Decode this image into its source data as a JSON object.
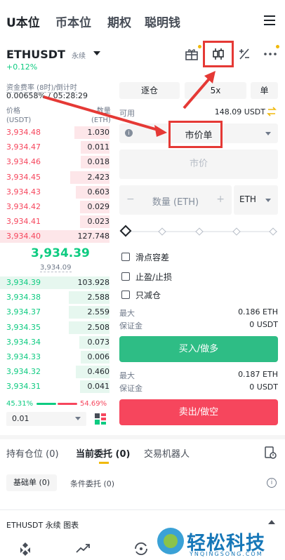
{
  "nav": {
    "tabs": [
      "U本位",
      "币本位",
      "期权",
      "聪明钱"
    ]
  },
  "symbol": {
    "name": "ETHUSDT",
    "type": "永续",
    "change": "+0.12%"
  },
  "funding": {
    "label": "资金费率 (8时)/倒计时",
    "value": "0.00658% / 05:28:29"
  },
  "orderbook": {
    "price_label": "价格",
    "price_unit": "(USDT)",
    "qty_label": "数量",
    "qty_unit": "(ETH)",
    "asks": [
      [
        "3,934.48",
        "1.030"
      ],
      [
        "3,934.47",
        "0.011"
      ],
      [
        "3,934.46",
        "0.018"
      ],
      [
        "3,934.45",
        "2.423"
      ],
      [
        "3,934.43",
        "0.603"
      ],
      [
        "3,934.42",
        "0.029"
      ],
      [
        "3,934.41",
        "0.023"
      ],
      [
        "3,934.40",
        "127.748"
      ]
    ],
    "last_price": "3,934.39",
    "mark_price": "3,934.09",
    "bids": [
      [
        "3,934.39",
        "103.928"
      ],
      [
        "3,934.38",
        "2.588"
      ],
      [
        "3,934.37",
        "2.559"
      ],
      [
        "3,934.35",
        "2.508"
      ],
      [
        "3,934.34",
        "0.073"
      ],
      [
        "3,934.33",
        "0.006"
      ],
      [
        "3,934.32",
        "0.460"
      ],
      [
        "3,934.31",
        "0.041"
      ]
    ],
    "buy_ratio": "45.31%",
    "sell_ratio": "54.69%",
    "precision": "0.01"
  },
  "form": {
    "margin_mode": "逐仓",
    "leverage": "5x",
    "mode": "单",
    "available_label": "可用",
    "available": "148.09 USDT",
    "order_type": "市价单",
    "price_placeholder": "市价",
    "qty_placeholder": "数量 (ETH)",
    "qty_unit": "ETH",
    "minus": "−",
    "plus": "+",
    "options": [
      "滑点容差",
      "止盈/止损",
      "只减仓"
    ],
    "buy_max_label": "最大",
    "buy_max": "0.186 ETH",
    "buy_margin_label": "保证金",
    "buy_margin": "0 USDT",
    "buy_btn": "买入/做多",
    "sell_max_label": "最大",
    "sell_max": "0.187 ETH",
    "sell_margin_label": "保证金",
    "sell_margin": "0 USDT",
    "sell_btn": "卖出/做空"
  },
  "orders": {
    "tabs": [
      "持有仓位 (0)",
      "当前委托 (0)",
      "交易机器人"
    ],
    "sub_tabs": [
      "基础单 (0)",
      "条件委托 (0)"
    ]
  },
  "footer": {
    "chart_label": "ETHUSDT 永续 图表"
  },
  "watermark": {
    "cn": "轻松科技",
    "en": "YNQINGSONG.COM"
  },
  "colors": {
    "buy": "#0ecb81",
    "sell": "#f6465d",
    "accent": "#f0b90b",
    "highlight": "#e53935"
  }
}
